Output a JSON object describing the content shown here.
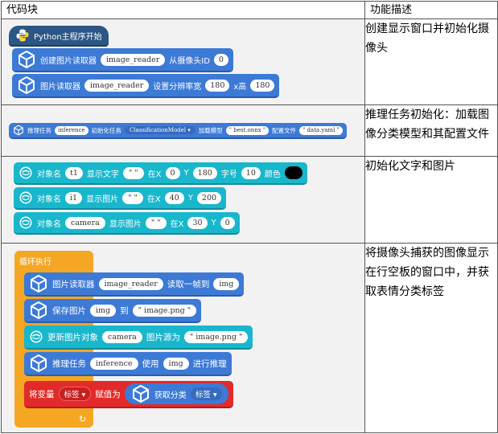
{
  "headers": {
    "code": "代码块",
    "desc": "功能描述"
  },
  "row1": {
    "desc": "创建显示窗口并初始化摄像头",
    "hat": "Python主程序开始",
    "b1": {
      "a": "创建图片读取器",
      "var": "image_reader",
      "b": "从摄像头ID",
      "id": "0"
    },
    "b2": {
      "a": "图片读取器",
      "var": "image_reader",
      "b": "设置分辨率宽",
      "w": "180",
      "c": "x高",
      "h": "180"
    }
  },
  "row2": {
    "desc": "推理任务初始化：加载图像分类模型和其配置文件",
    "b1": {
      "a": "推理任务",
      "var": "inference",
      "b": "初始化任务",
      "task": "ClassificationModel",
      "c": "加载模型",
      "model": "\" best.onnx \"",
      "d": "配置文件",
      "cfg": "\" data.yaml \""
    }
  },
  "row3": {
    "desc": "初始化文字和图片",
    "b1": {
      "a": "对象名",
      "obj": "t1",
      "b": "显示文字",
      "txt": "\" \"",
      "c": "在X",
      "x": "0",
      "d": "Y",
      "y": "180",
      "e": "字号",
      "size": "10",
      "f": "颜色"
    },
    "b2": {
      "a": "对象名",
      "obj": "i1",
      "b": "显示图片",
      "txt": "\" \"",
      "c": "在X",
      "x": "40",
      "d": "Y",
      "y": "200"
    },
    "b3": {
      "a": "对象名",
      "obj": "camera",
      "b": "显示图片",
      "txt": "\" \"",
      "c": "在X",
      "x": "30",
      "d": "Y",
      "y": "0"
    },
    "color": "#000000"
  },
  "row4": {
    "desc": "将摄像头捕获的图像显示在行空板的窗口中，并获取表情分类标签",
    "loop": "循环执行",
    "b1": {
      "a": "图片读取器",
      "var": "image_reader",
      "b": "读取一帧到",
      "img": "img"
    },
    "b2": {
      "a": "保存图片",
      "img": "img",
      "b": "到",
      "file": "\" image.png \""
    },
    "b3": {
      "a": "更新图片对象",
      "obj": "camera",
      "b": "图片源为",
      "file": "\" image.png \""
    },
    "b4": {
      "a": "推理任务",
      "var": "inference",
      "b": "使用",
      "img": "img",
      "c": "进行推理"
    },
    "b5": {
      "a": "将变量",
      "var": "标签",
      "b": "赋值为",
      "c": "获取分类",
      "d": "标签"
    }
  }
}
